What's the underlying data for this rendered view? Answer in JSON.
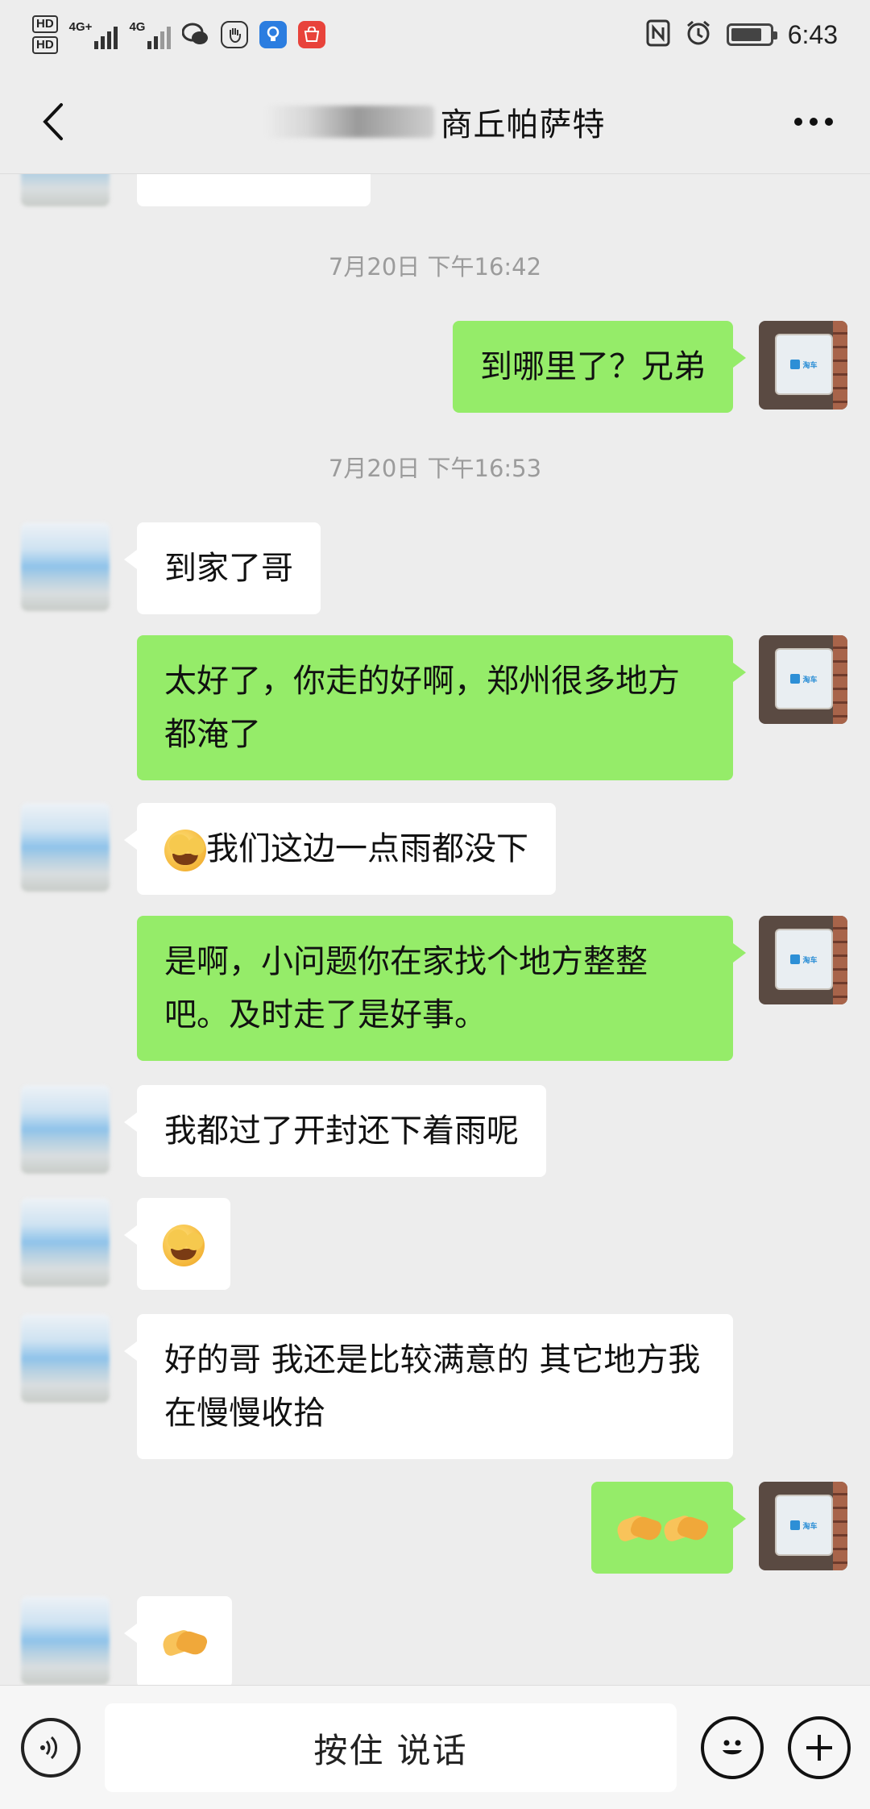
{
  "status_bar": {
    "sim1": "HD",
    "sim2": "HD",
    "net1": "4G+",
    "net2": "4G",
    "time": "6:43",
    "battery_level": 0.8
  },
  "header": {
    "title": "商丘帕萨特"
  },
  "messages": [
    {
      "type": "timestamp",
      "text": "7月20日 下午16:42"
    },
    {
      "type": "out",
      "text": "到哪里了？兄弟"
    },
    {
      "type": "timestamp",
      "text": "7月20日 下午16:53"
    },
    {
      "type": "in",
      "text": "到家了哥"
    },
    {
      "type": "out",
      "text": "太好了，你走的好啊，郑州很多地方都淹了"
    },
    {
      "type": "in",
      "emoji": "facepalm-emoji",
      "text": "我们这边一点雨都没下"
    },
    {
      "type": "out",
      "text": "是啊，小问题你在家找个地方整整吧。及时走了是好事。"
    },
    {
      "type": "in",
      "text": "我都过了开封还下着雨呢"
    },
    {
      "type": "in",
      "emoji": "facepalm-emoji"
    },
    {
      "type": "in",
      "text": "好的哥 我还是比较满意的 其它地方我在慢慢收拾"
    },
    {
      "type": "out",
      "emoji": "handshake-emoji x2"
    },
    {
      "type": "in",
      "emoji": "handshake-emoji"
    }
  ],
  "bottom_bar": {
    "voice_button_label": "按住 说话"
  },
  "colors": {
    "background": "#ededed",
    "outgoing_bubble": "#95ec69",
    "incoming_bubble": "#ffffff",
    "timestamp_text": "#9b9b9b"
  }
}
